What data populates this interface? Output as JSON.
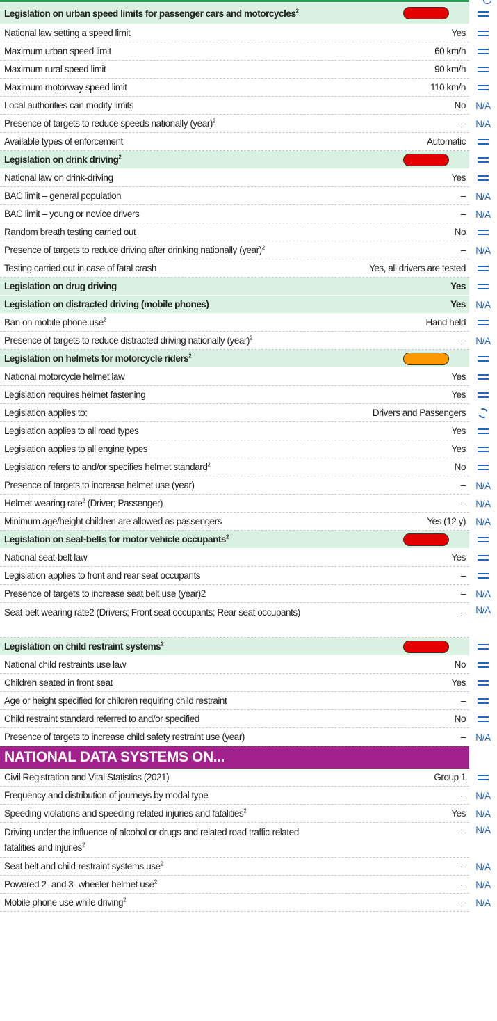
{
  "rows": [
    {
      "t": "s",
      "label": "Legislation on urban speed limits for passenger cars and motorcycles",
      "sup": "2",
      "value": "",
      "rating": "red",
      "trend": "eq",
      "h": 31
    },
    {
      "t": "r",
      "label": "National law setting a speed limit",
      "sup": "",
      "value": "Yes",
      "trend": "eq",
      "h": 26
    },
    {
      "t": "r",
      "label": "Maximum urban speed limit",
      "sup": "",
      "value": "60 km/h",
      "trend": "eq",
      "h": 26
    },
    {
      "t": "r",
      "label": "Maximum rural speed limit",
      "sup": "",
      "value": "90 km/h",
      "trend": "eq",
      "h": 26
    },
    {
      "t": "r",
      "label": "Maximum motorway speed limit",
      "sup": "",
      "value": "110 km/h",
      "trend": "eq",
      "h": 26
    },
    {
      "t": "r",
      "label": "Local authorities can modify limits",
      "sup": "",
      "value": "No",
      "trend": "N/A",
      "h": 26
    },
    {
      "t": "r",
      "label": "Presence of targets to reduce speeds nationally (year)",
      "sup": "2",
      "value": "–",
      "trend": "N/A",
      "h": 26
    },
    {
      "t": "r",
      "label": "Available types of enforcement",
      "sup": "",
      "value": "Automatic",
      "trend": "eq",
      "h": 26
    },
    {
      "t": "s",
      "label": "Legislation on drink driving",
      "sup": "2",
      "value": "",
      "rating": "red",
      "trend": "eq",
      "h": 26
    },
    {
      "t": "r",
      "label": "National law on drink-driving",
      "sup": "",
      "value": "Yes",
      "trend": "eq",
      "h": 26
    },
    {
      "t": "r",
      "label": "BAC limit – general population",
      "sup": "",
      "value": "–",
      "trend": "N/A",
      "h": 26
    },
    {
      "t": "r",
      "label": "BAC limit – young or novice drivers",
      "sup": "",
      "value": "–",
      "trend": "N/A",
      "h": 26
    },
    {
      "t": "r",
      "label": "Random breath testing carried out",
      "sup": "",
      "value": "No",
      "trend": "eq",
      "h": 26
    },
    {
      "t": "r",
      "label": "Presence of targets to reduce driving after drinking nationally (year)",
      "sup": "2",
      "value": "–",
      "trend": "N/A",
      "h": 26
    },
    {
      "t": "r",
      "label": "Testing carried out in case of fatal crash",
      "sup": "",
      "value": "Yes, all drivers are tested",
      "trend": "eq",
      "h": 26
    },
    {
      "t": "s",
      "label": "Legislation on drug driving",
      "sup": "",
      "value": "Yes",
      "trend": "eq",
      "h": 26
    },
    {
      "t": "s",
      "label": "Legislation on distracted driving (mobile phones)",
      "sup": "",
      "value": "Yes",
      "trend": "N/A",
      "h": 26
    },
    {
      "t": "r",
      "label": "Ban on mobile phone use",
      "sup": "2",
      "value": "Hand held",
      "trend": "eq",
      "h": 26
    },
    {
      "t": "r",
      "label": "Presence of targets to reduce distracted driving nationally (year)",
      "sup": "2",
      "value": "–",
      "trend": "N/A",
      "h": 26
    },
    {
      "t": "s",
      "label": "Legislation on helmets for motorcycle riders",
      "sup": "2",
      "value": "",
      "rating": "orange",
      "trend": "eq",
      "h": 26
    },
    {
      "t": "r",
      "label": "National motorcycle helmet law",
      "sup": "",
      "value": "Yes",
      "trend": "eq",
      "h": 26
    },
    {
      "t": "r",
      "label": "Legislation requires helmet fastening",
      "sup": "",
      "value": "Yes",
      "trend": "eq",
      "h": 26
    },
    {
      "t": "r",
      "label": "Legislation applies to:",
      "sup": "",
      "value": "Drivers and Passengers",
      "trend": "refresh",
      "h": 26
    },
    {
      "t": "r",
      "label": "Legislation applies to all road types",
      "sup": "",
      "value": "Yes",
      "trend": "eq",
      "h": 26
    },
    {
      "t": "r",
      "label": "Legislation applies to all engine types",
      "sup": "",
      "value": "Yes",
      "trend": "eq",
      "h": 26
    },
    {
      "t": "r",
      "label": "Legislation refers to and/or specifies helmet standard",
      "sup": "2",
      "value": "No",
      "trend": "eq",
      "h": 26
    },
    {
      "t": "r",
      "label": "Presence of targets to increase helmet use (year)",
      "sup": "",
      "value": "–",
      "trend": "N/A",
      "h": 26
    },
    {
      "t": "r",
      "label": "Helmet wearing rate",
      "sup": "2",
      "after": " (Driver; Passenger)",
      "value": "–",
      "trend": "N/A",
      "h": 26
    },
    {
      "t": "r",
      "label": "Minimum age/height children are allowed as passengers",
      "sup": "",
      "value": "Yes (12 y)",
      "trend": "N/A",
      "h": 26
    },
    {
      "t": "s",
      "label": "Legislation on seat-belts for motor vehicle occupants",
      "sup": "2",
      "value": "",
      "rating": "red",
      "trend": "eq",
      "h": 26
    },
    {
      "t": "r",
      "label": "National seat-belt law",
      "sup": "",
      "value": "Yes",
      "trend": "eq",
      "h": 26
    },
    {
      "t": "r",
      "label": "Legislation applies to front and rear seat occupants",
      "sup": "",
      "value": "–",
      "trend": "eq",
      "h": 26
    },
    {
      "t": "r",
      "label": "Presence of targets to increase seat belt use (year)2",
      "sup": "",
      "value": "–",
      "trend": "N/A",
      "h": 26
    },
    {
      "t": "r",
      "label": "Seat-belt wearing rate2 (Drivers; Front seat occupants; Rear seat occupants)",
      "sup": "",
      "value": "–",
      "trend": "N/A",
      "h": 50,
      "tall": true
    },
    {
      "t": "s",
      "label": "Legislation on child restraint systems",
      "sup": "2",
      "value": "",
      "rating": "red",
      "trend": "eq",
      "h": 26
    },
    {
      "t": "r",
      "label": "National child restraints use law",
      "sup": "",
      "value": "No",
      "trend": "eq",
      "h": 26
    },
    {
      "t": "r",
      "label": "Children seated in front seat",
      "sup": "",
      "value": "Yes",
      "trend": "eq",
      "h": 26
    },
    {
      "t": "r",
      "label": "Age or height specified for children requiring child restraint",
      "sup": "",
      "value": "–",
      "trend": "eq",
      "h": 26
    },
    {
      "t": "r",
      "label": "Child restraint standard referred to and/or specified",
      "sup": "",
      "value": "No",
      "trend": "eq",
      "h": 26
    },
    {
      "t": "r",
      "label": "Presence of targets to increase child safety restraint use (year)",
      "sup": "",
      "value": "–",
      "trend": "N/A",
      "h": 26
    },
    {
      "t": "b",
      "label": "NATIONAL DATA SYSTEMS ON...",
      "h": 32
    },
    {
      "t": "r",
      "label": "Civil Registration and Vital Statistics (2021)",
      "sup": "",
      "value": "Group 1",
      "trend": "eq",
      "h": 26
    },
    {
      "t": "r",
      "label": "Frequency and distribution of journeys by modal type",
      "sup": "",
      "value": "–",
      "trend": "N/A",
      "h": 26
    },
    {
      "t": "r",
      "label": "Speeding violations and speeding related injuries and fatalities",
      "sup": "2",
      "value": "Yes",
      "trend": "N/A",
      "h": 26
    },
    {
      "t": "r",
      "label": "Driving under the influence of alcohol or drugs and related road traffic-related fatalities and injuries",
      "sup": "2",
      "value": "–",
      "trend": "N/A",
      "h": 50,
      "tall": true
    },
    {
      "t": "r",
      "label": "Seat belt and child-restraint systems use",
      "sup": "2",
      "value": "–",
      "trend": "N/A",
      "h": 26
    },
    {
      "t": "r",
      "label": "Powered 2- and 3- wheeler helmet use",
      "sup": "2",
      "value": "–",
      "trend": "N/A",
      "h": 26
    },
    {
      "t": "r",
      "label": "Mobile phone use while driving",
      "sup": "2",
      "value": "–",
      "trend": "N/A",
      "h": 26
    }
  ],
  "colors": {
    "section_bg": "#d9f1e1",
    "banner_bg": "#a3218c",
    "trend_blue": "#1e64c8",
    "rating_red": "#e40000",
    "rating_orange": "#ff9900"
  }
}
